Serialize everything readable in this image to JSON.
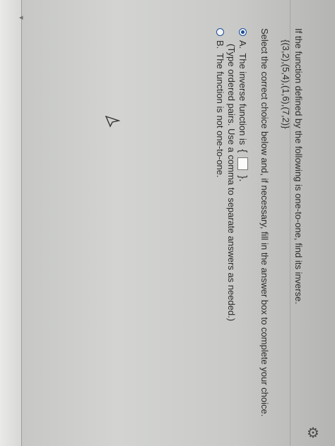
{
  "question": {
    "prompt": "If the function defined by the following is one-to-one, find its inverse.",
    "set": "{(3,2),(5,4),(1,6),(7,2)}"
  },
  "instruction": "Select the correct choice below and, if necessary, fill in the answer box to complete your choice.",
  "options": [
    {
      "letter": "A.",
      "text_before": "The inverse function is",
      "brace_open": "{",
      "brace_close": "}.",
      "hint": "(Type ordered pairs. Use a comma to separate answers as needed.)",
      "selected": true
    },
    {
      "letter": "B.",
      "text": "The function is not one-to-one.",
      "selected": false
    }
  ],
  "icons": {
    "settings": "gear-icon",
    "pointer": "cursor-icon"
  },
  "colors": {
    "radio_accent": "#1a4e9a",
    "text": "#2c2c2c"
  }
}
